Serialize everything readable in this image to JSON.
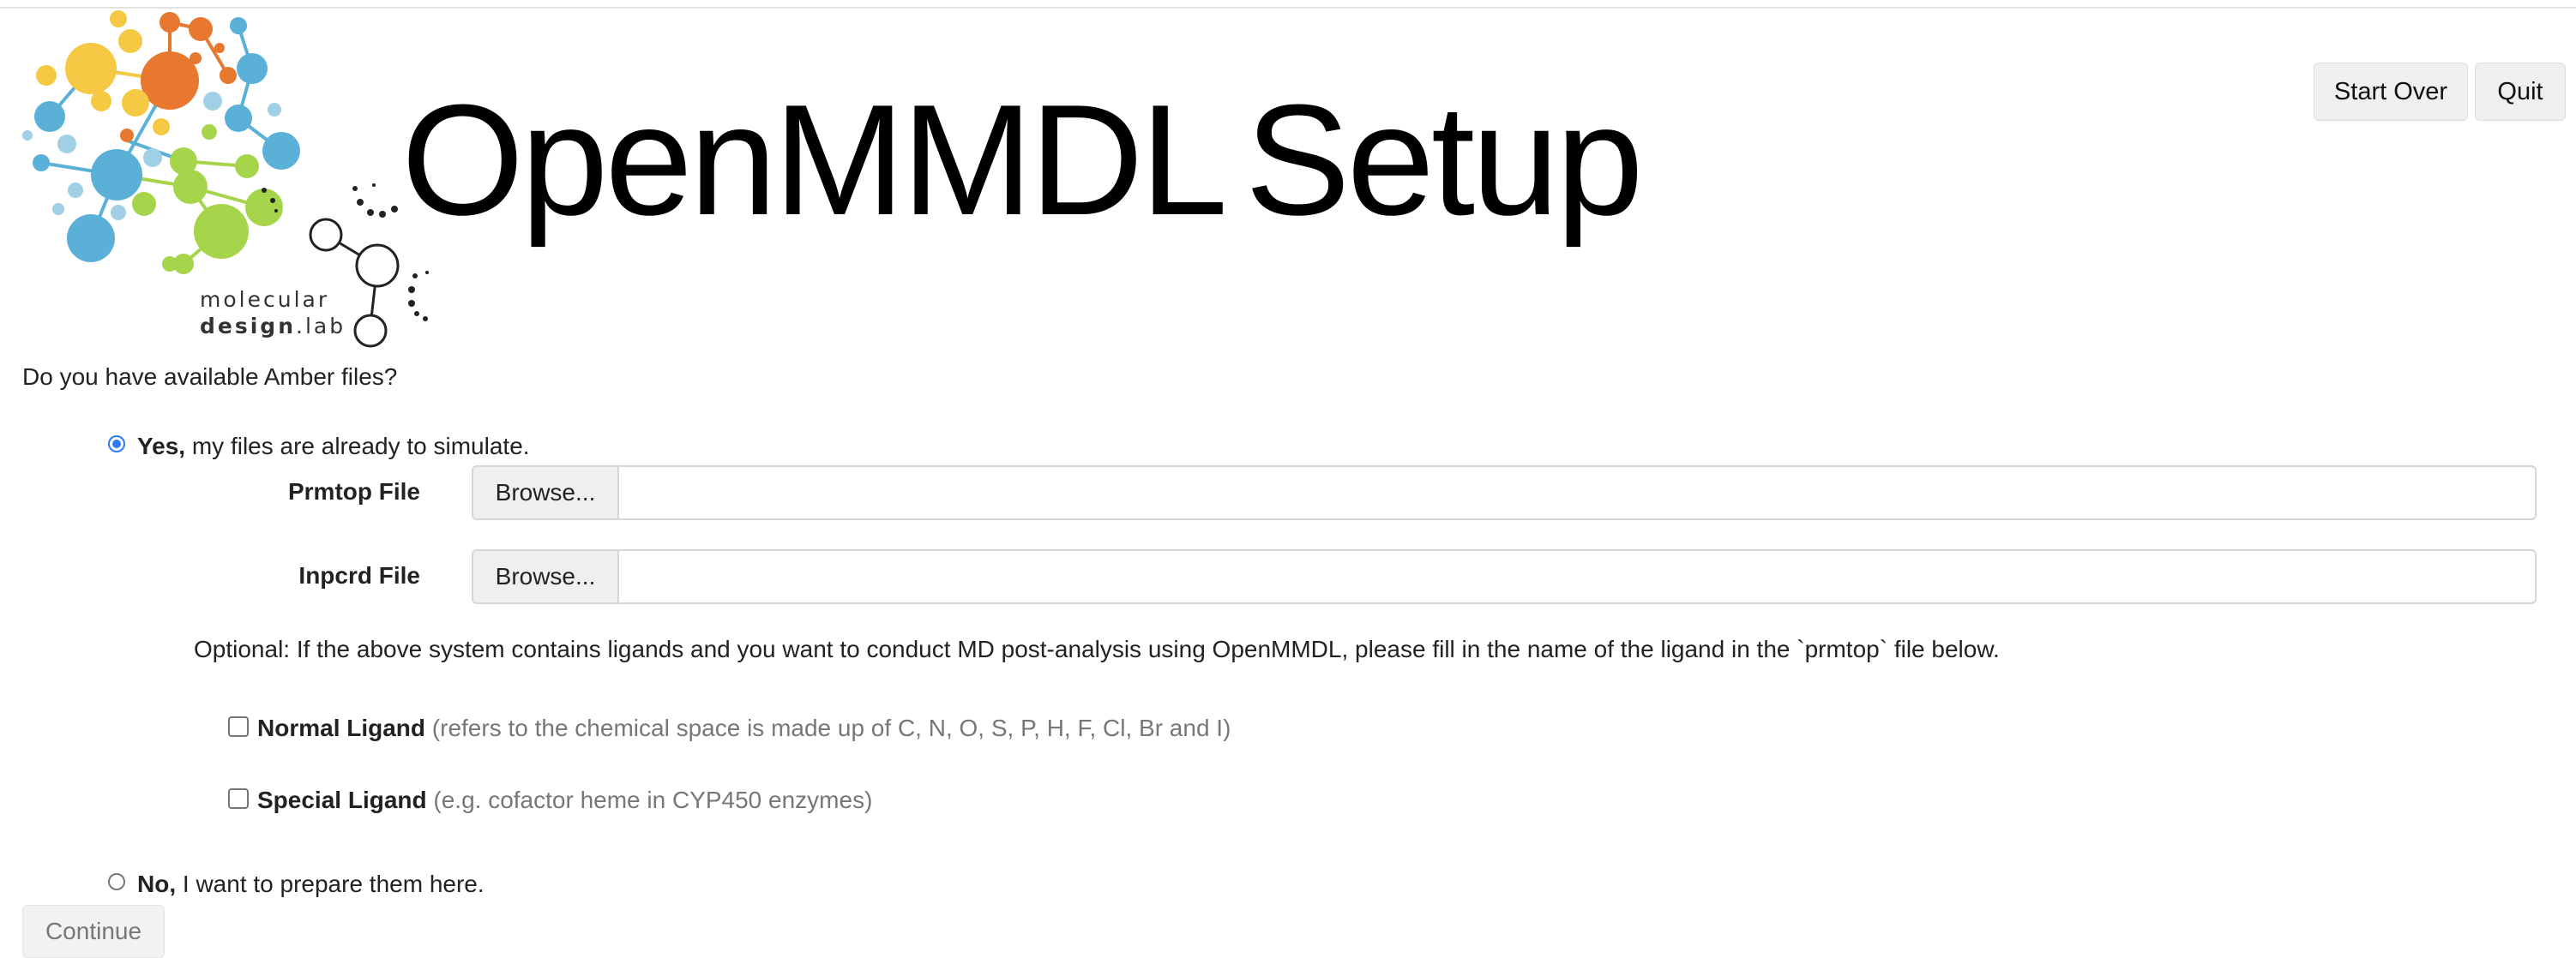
{
  "logo": {
    "line1": "molecular",
    "line2_bold": "design",
    "line2_rest": ".lab"
  },
  "header": {
    "title_part1": "OpenMMDL",
    "title_part2": "Setup",
    "start_over_label": "Start Over",
    "quit_label": "Quit"
  },
  "form": {
    "question": "Do you have available Amber files?",
    "options": [
      {
        "bold": "Yes,",
        "text": " my files are already to simulate.",
        "selected": true
      },
      {
        "bold": "No,",
        "text": " I want to prepare them here.",
        "selected": false
      }
    ],
    "files": [
      {
        "label": "Prmtop File",
        "button": "Browse...",
        "value": ""
      },
      {
        "label": "Inpcrd File",
        "button": "Browse...",
        "value": ""
      }
    ],
    "optional_note": "Optional: If the above system contains ligands and you want to conduct MD post-analysis using OpenMMDL, please fill in the name of the ligand in the `prmtop` file below.",
    "ligands": [
      {
        "bold": "Normal Ligand",
        "hint": " (refers to the chemical space is made up of C, N, O, S, P, H, F, Cl, Br and I)",
        "checked": false
      },
      {
        "bold": "Special Ligand",
        "hint": " (e.g. cofactor heme in CYP450 enzymes)",
        "checked": false
      }
    ],
    "continue_label": "Continue"
  },
  "colors": {
    "radio_accent": "#2e7bf6",
    "logo_orange": "#e8782f",
    "logo_yellow": "#f6c944",
    "logo_blue": "#5ab0d6",
    "logo_green": "#a6d44a"
  }
}
